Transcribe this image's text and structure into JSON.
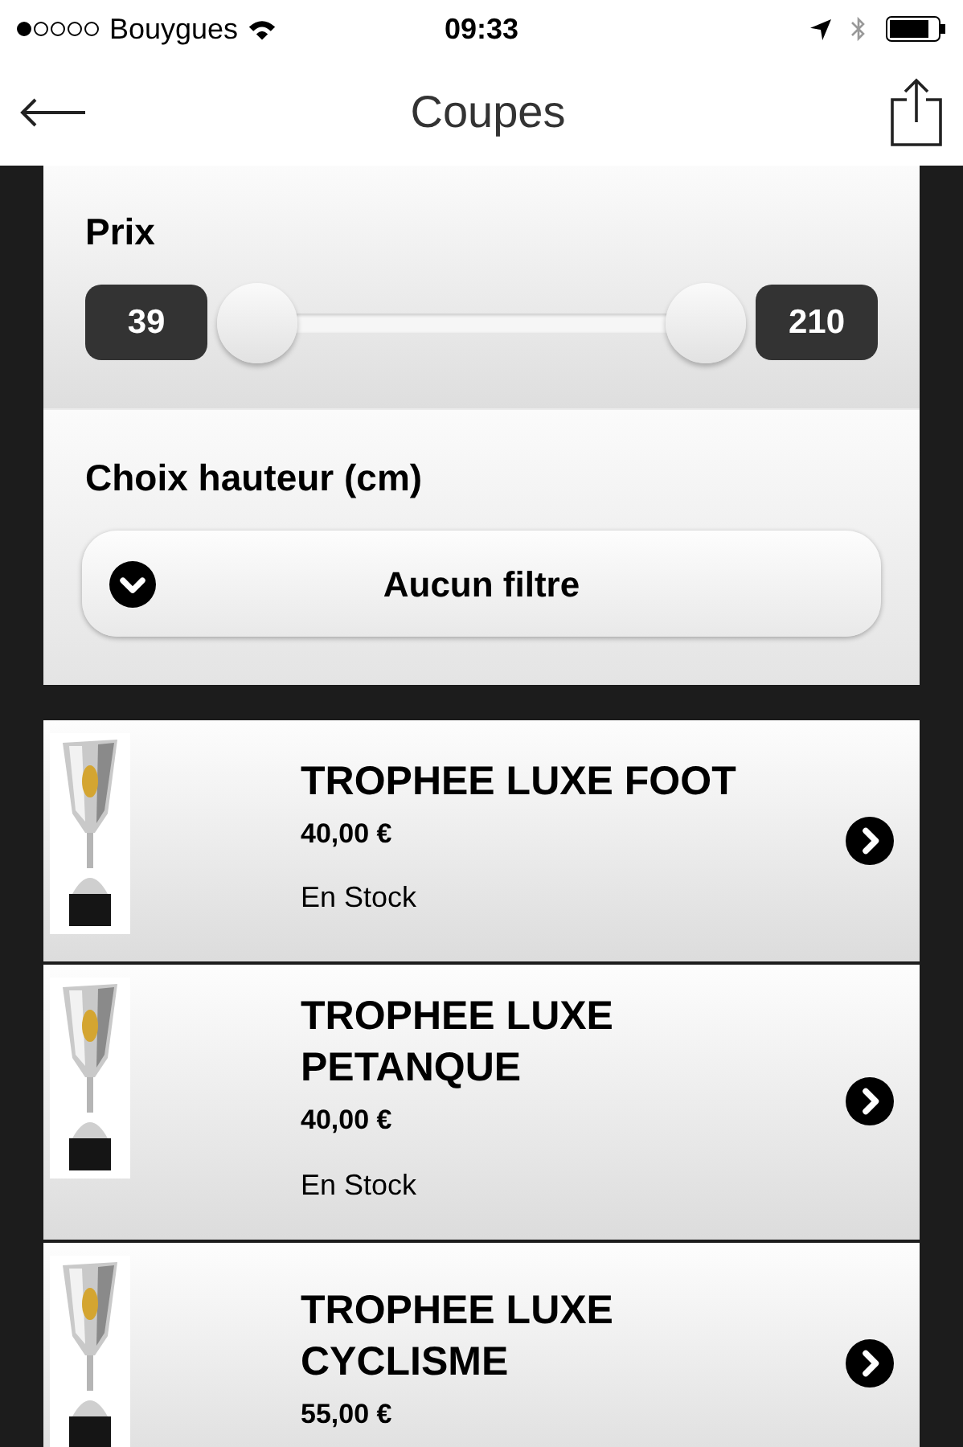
{
  "status_bar": {
    "carrier": "Bouygues",
    "time": "09:33"
  },
  "nav": {
    "title": "Coupes"
  },
  "filters": {
    "price": {
      "label": "Prix",
      "min": "39",
      "max": "210",
      "thumbs": [
        {
          "level": 0
        },
        {
          "level": 1
        }
      ]
    },
    "height": {
      "label": "Choix hauteur (cm)",
      "value": "Aucun filtre"
    }
  },
  "products": [
    {
      "name": "TROPHEE LUXE FOOT",
      "price": "40,00 €",
      "stock": "En Stock"
    },
    {
      "name": "TROPHEE LUXE PETANQUE",
      "price": "40,00 €",
      "stock": "En Stock"
    },
    {
      "name": "TROPHEE LUXE CYCLISME",
      "price": "55,00 €"
    }
  ]
}
